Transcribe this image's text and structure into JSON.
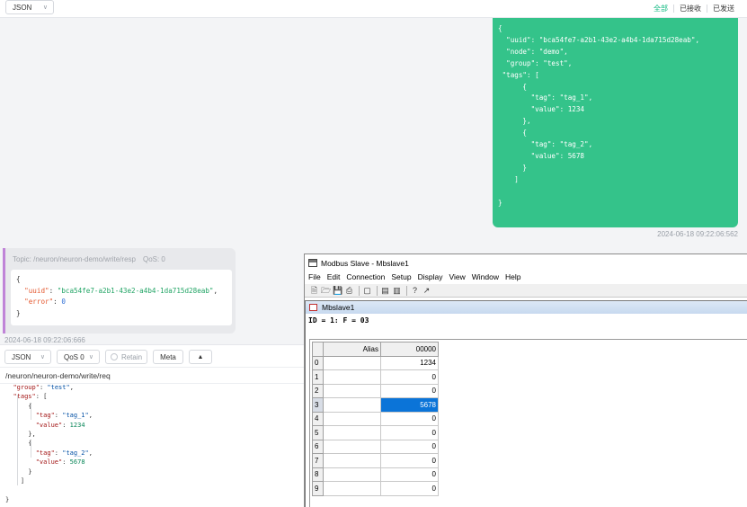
{
  "topbar": {
    "format_select": "JSON",
    "filters": [
      "全部",
      "已接收",
      "已发送"
    ],
    "active_filter": "全部"
  },
  "sent_message": {
    "payload_lines": [
      "{",
      "  \"uuid\": \"bca54fe7-a2b1-43e2-a4b4-1da715d28eab\",",
      "  \"node\": \"demo\",",
      "  \"group\": \"test\",",
      " \"tags\": [",
      "      {",
      "        \"tag\": \"tag_1\",",
      "        \"value\": 1234",
      "      },",
      "      {",
      "        \"tag\": \"tag_2\",",
      "        \"value\": 5678",
      "      }",
      "    ]",
      "",
      "}"
    ],
    "timestamp": "2024-06-18 09:22:06:562"
  },
  "received_message": {
    "topic": "Topic: /neuron/neuron-demo/write/resp",
    "qos": "QoS: 0",
    "uuid_key": "\"uuid\"",
    "uuid_value": "\"bca54fe7-a2b1-43e2-a4b4-1da715d28eab\"",
    "error_key": "\"error\"",
    "error_value": "0",
    "timestamp": "2024-06-18 09:22:06:666"
  },
  "publish": {
    "format_select": "JSON",
    "qos_select": "QoS 0",
    "retain_label": "Retain",
    "meta_label": "Meta",
    "topic": "/neuron/neuron-demo/write/req",
    "editor": {
      "group_key": "\"group\"",
      "group_value": "\"test\"",
      "tags_key": "\"tags\"",
      "tag_key": "\"tag\"",
      "value_key": "\"value\"",
      "tag1_name": "\"tag_1\"",
      "tag1_value": "1234",
      "tag2_name": "\"tag_2\"",
      "tag2_value": "5678"
    }
  },
  "modbus": {
    "window_title": "Modbus Slave - Mbslave1",
    "menu": [
      "File",
      "Edit",
      "Connection",
      "Setup",
      "Display",
      "View",
      "Window",
      "Help"
    ],
    "child_title": "Mbslave1",
    "id_line": "ID = 1: F = 03",
    "columns": [
      "Alias",
      "00000"
    ],
    "rows": [
      {
        "index": "0",
        "alias": "",
        "value": "1234"
      },
      {
        "index": "1",
        "alias": "",
        "value": "0"
      },
      {
        "index": "2",
        "alias": "",
        "value": "0"
      },
      {
        "index": "3",
        "alias": "",
        "value": "5678"
      },
      {
        "index": "4",
        "alias": "",
        "value": "0"
      },
      {
        "index": "5",
        "alias": "",
        "value": "0"
      },
      {
        "index": "6",
        "alias": "",
        "value": "0"
      },
      {
        "index": "7",
        "alias": "",
        "value": "0"
      },
      {
        "index": "8",
        "alias": "",
        "value": "0"
      },
      {
        "index": "9",
        "alias": "",
        "value": "0"
      }
    ],
    "selected_row": 3
  },
  "colors": {
    "accent_green": "#34c38a",
    "selection_blue": "#0b74d8",
    "recv_border": "#c084d8"
  }
}
